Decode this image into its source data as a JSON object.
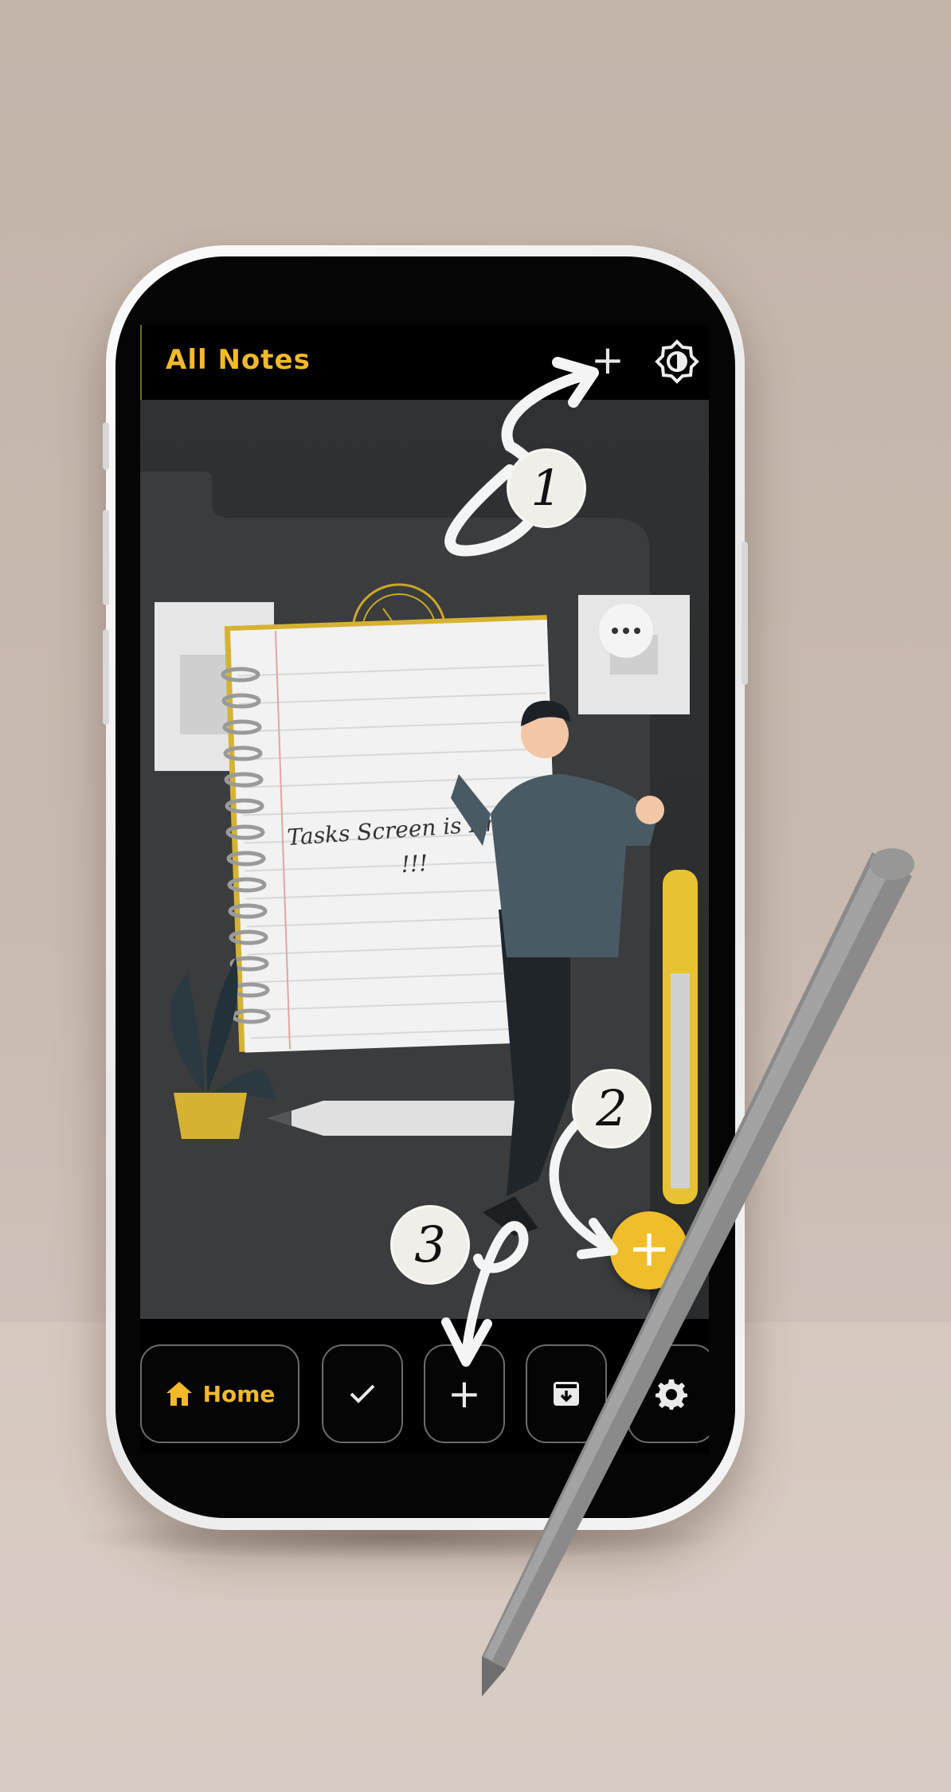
{
  "app": {
    "header": {
      "title": "All Notes",
      "add_icon": "plus-icon",
      "theme_icon": "brightness-icon"
    },
    "empty_state": {
      "line1": "Tasks Screen is Empty",
      "line2": "!!!"
    },
    "fab": {
      "label": "+",
      "color": "#f0bd2b"
    },
    "bottom_nav": {
      "home_label": "Home",
      "home_icon": "home-icon",
      "tasks_icon": "check-icon",
      "add_icon": "plus-icon",
      "add_label": "+",
      "archive_icon": "archive-icon",
      "settings_icon": "gear-icon"
    }
  },
  "callouts": {
    "one": "1",
    "two": "2",
    "three": "3"
  },
  "colors": {
    "accent": "#f2b929",
    "background": "#2a2c2d",
    "bar": "#000000"
  }
}
